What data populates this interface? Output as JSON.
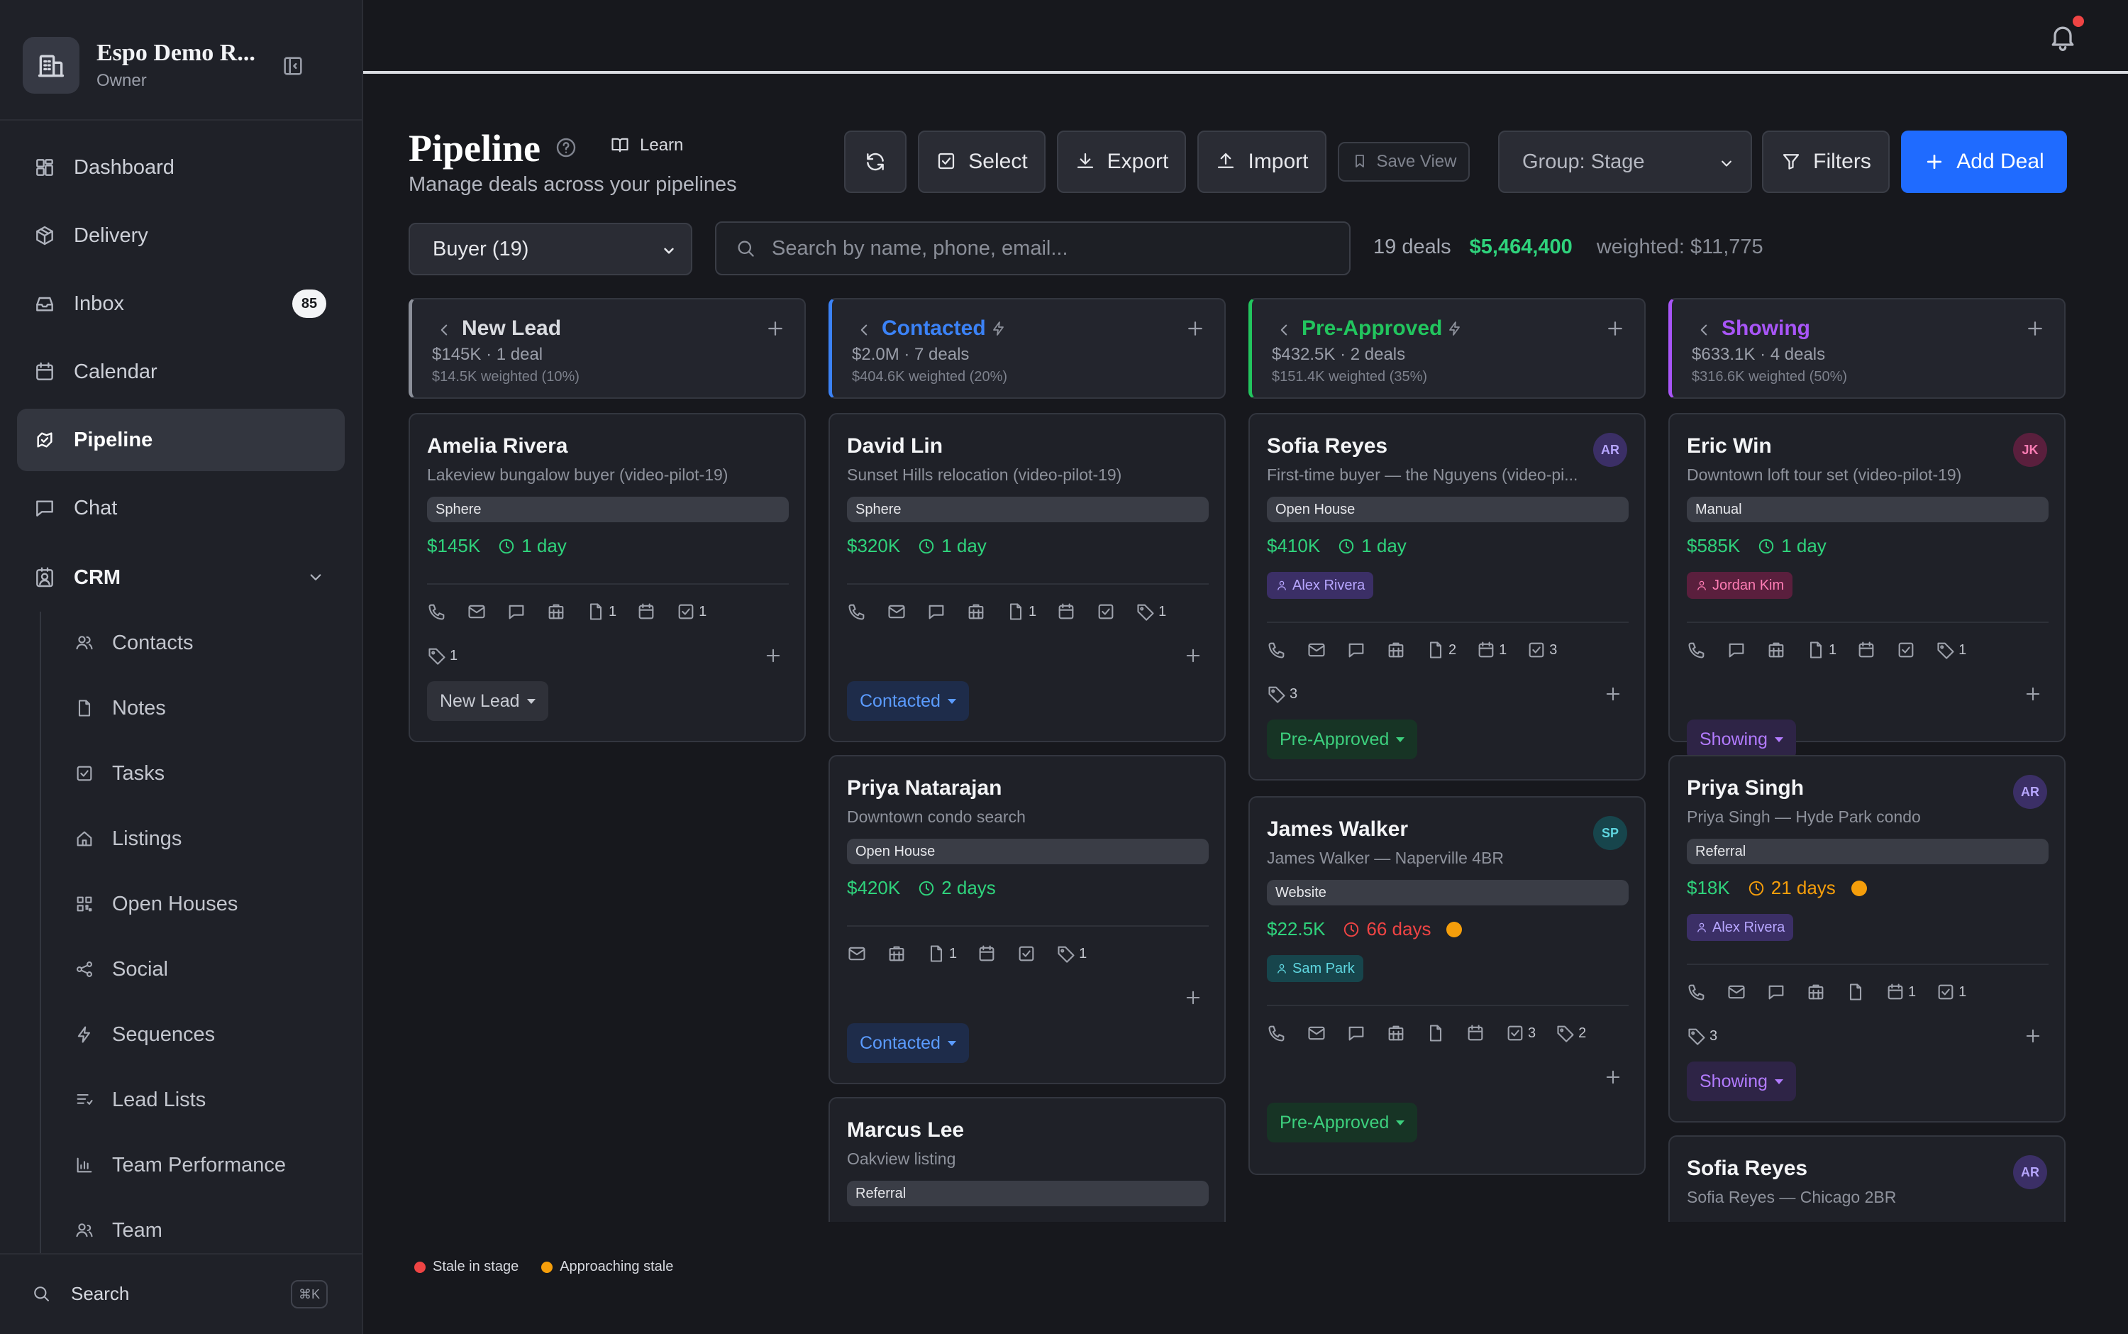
{
  "workspace": {
    "name": "Espo Demo R...",
    "role": "Owner"
  },
  "nav": {
    "items": [
      {
        "label": "Dashboard",
        "icon": "dashboard-icon"
      },
      {
        "label": "Delivery",
        "icon": "package-icon"
      },
      {
        "label": "Inbox",
        "icon": "inbox-icon",
        "badge": "85"
      },
      {
        "label": "Calendar",
        "icon": "calendar-icon"
      },
      {
        "label": "Pipeline",
        "icon": "pipeline-icon",
        "active": true
      },
      {
        "label": "Chat",
        "icon": "chat-icon"
      },
      {
        "label": "CRM",
        "icon": "crm-icon",
        "expanded": true
      }
    ],
    "crm_items": [
      {
        "label": "Contacts",
        "icon": "contacts-icon"
      },
      {
        "label": "Notes",
        "icon": "notes-icon"
      },
      {
        "label": "Tasks",
        "icon": "tasks-icon"
      },
      {
        "label": "Listings",
        "icon": "home-icon"
      },
      {
        "label": "Open Houses",
        "icon": "qr-icon"
      },
      {
        "label": "Social",
        "icon": "share-icon"
      },
      {
        "label": "Sequences",
        "icon": "bolt-icon"
      },
      {
        "label": "Lead Lists",
        "icon": "list-icon"
      },
      {
        "label": "Team Performance",
        "icon": "bar-chart-icon"
      },
      {
        "label": "Team",
        "icon": "team-icon"
      }
    ],
    "search_label": "Search",
    "search_shortcut": "⌘K"
  },
  "header": {
    "title": "Pipeline",
    "subtitle": "Manage deals across your pipelines",
    "learn_label": "Learn",
    "toolbar": {
      "select_label": "Select",
      "export_label": "Export",
      "import_label": "Import",
      "save_view_label": "Save View",
      "group_value": "Group: Stage",
      "filters_label": "Filters",
      "add_deal_label": "Add Deal"
    }
  },
  "filters": {
    "pipeline_value": "Buyer (19)",
    "search_placeholder": "Search by name, phone, email..."
  },
  "stats": {
    "count": "19 deals",
    "total": "$5,464,400",
    "weighted": "weighted: $11,775"
  },
  "colors": {
    "new_lead": "#8b8f99",
    "contacted": "#3b82f6",
    "pre_approved": "#22c55e",
    "showing": "#a855f7",
    "value": "#2fd37c",
    "stale": "#ef4444",
    "approaching_stale": "#f59e0b",
    "accent": "#1f6bff"
  },
  "columns": [
    {
      "title": "New Lead",
      "summary": "$145K · 1 deal",
      "weighted": "$14.5K weighted (10%)",
      "cards": [
        {
          "name": "Amelia Rivera",
          "desc": "Lakeview bungalow buyer (video-pilot-19)",
          "source": "Sphere",
          "value": "$145K",
          "age": "1 day",
          "actions": [
            [
              "phone-icon",
              ""
            ],
            [
              "mail-icon",
              ""
            ],
            [
              "message-icon",
              ""
            ],
            [
              "building-icon",
              ""
            ],
            [
              "file-icon",
              "1"
            ],
            [
              "calendar-icon",
              ""
            ],
            [
              "checkbox-icon",
              "1"
            ]
          ],
          "actions2": [
            [
              "tag-icon",
              "1"
            ]
          ],
          "stage": "New Lead"
        }
      ]
    },
    {
      "title": "Contacted",
      "summary": "$2.0M · 7 deals",
      "weighted": "$404.6K weighted (20%)",
      "cards": [
        {
          "name": "David Lin",
          "desc": "Sunset Hills relocation (video-pilot-19)",
          "source": "Sphere",
          "value": "$320K",
          "age": "1 day",
          "actions": [
            [
              "phone-icon",
              ""
            ],
            [
              "mail-icon",
              ""
            ],
            [
              "message-icon",
              ""
            ],
            [
              "building-icon",
              ""
            ],
            [
              "file-icon",
              "1"
            ],
            [
              "calendar-icon",
              ""
            ],
            [
              "checkbox-icon",
              ""
            ],
            [
              "tag-icon",
              "1"
            ]
          ],
          "stage": "Contacted"
        },
        {
          "name": "Priya Natarajan",
          "desc": "Downtown condo search",
          "source": "Open House",
          "value": "$420K",
          "age": "2 days",
          "actions": [
            [
              "mail-icon",
              ""
            ],
            [
              "building-icon",
              ""
            ],
            [
              "file-icon",
              "1"
            ],
            [
              "calendar-icon",
              ""
            ],
            [
              "checkbox-icon",
              ""
            ],
            [
              "tag-icon",
              "1"
            ]
          ],
          "stage": "Contacted"
        },
        {
          "name": "Marcus Lee",
          "desc": "Oakview listing",
          "source": "Referral"
        }
      ]
    },
    {
      "title": "Pre-Approved",
      "summary": "$432.5K · 2 deals",
      "weighted": "$151.4K weighted (35%)",
      "cards": [
        {
          "name": "Sofia Reyes",
          "desc": "First-time buyer — the Nguyens (video-pi...",
          "avatar": "AR",
          "source": "Open House",
          "value": "$410K",
          "age": "1 day",
          "agent": "Alex Rivera",
          "actions": [
            [
              "phone-icon",
              ""
            ],
            [
              "mail-icon",
              ""
            ],
            [
              "message-icon",
              ""
            ],
            [
              "building-icon",
              ""
            ],
            [
              "file-icon",
              "2"
            ],
            [
              "calendar-icon",
              "1"
            ],
            [
              "checkbox-icon",
              "3"
            ]
          ],
          "actions2": [
            [
              "tag-icon",
              "3"
            ]
          ],
          "stage": "Pre-Approved"
        },
        {
          "name": "James Walker",
          "desc": "James Walker — Naperville 4BR",
          "avatar": "SP",
          "source": "Website",
          "value": "$22.5K",
          "age": "66 days",
          "agent": "Sam Park",
          "actions": [
            [
              "phone-icon",
              ""
            ],
            [
              "mail-icon",
              ""
            ],
            [
              "message-icon",
              ""
            ],
            [
              "building-icon",
              ""
            ],
            [
              "file-icon",
              ""
            ],
            [
              "calendar-icon",
              ""
            ],
            [
              "checkbox-icon",
              "3"
            ],
            [
              "tag-icon",
              "2"
            ]
          ],
          "stage": "Pre-Approved"
        }
      ]
    },
    {
      "title": "Showing",
      "summary": "$633.1K · 4 deals",
      "weighted": "$316.6K weighted (50%)",
      "cards": [
        {
          "name": "Eric Win",
          "desc": "Downtown loft tour set (video-pilot-19)",
          "avatar": "JK",
          "source": "Manual",
          "value": "$585K",
          "age": "1 day",
          "agent": "Jordan Kim",
          "actions": [
            [
              "phone-icon",
              ""
            ],
            [
              "message-icon",
              ""
            ],
            [
              "building-icon",
              ""
            ],
            [
              "file-icon",
              "1"
            ],
            [
              "calendar-icon",
              ""
            ],
            [
              "checkbox-icon",
              ""
            ],
            [
              "tag-icon",
              "1"
            ]
          ],
          "stage": "Showing"
        },
        {
          "name": "Priya Singh",
          "desc": "Priya Singh — Hyde Park condo",
          "avatar": "AR",
          "source": "Referral",
          "value": "$18K",
          "age": "21 days",
          "agent": "Alex Rivera",
          "actions": [
            [
              "phone-icon",
              ""
            ],
            [
              "mail-icon",
              ""
            ],
            [
              "message-icon",
              ""
            ],
            [
              "building-icon",
              ""
            ],
            [
              "file-icon",
              ""
            ],
            [
              "calendar-icon",
              "1"
            ],
            [
              "checkbox-icon",
              "1"
            ]
          ],
          "actions2": [
            [
              "tag-icon",
              "3"
            ]
          ],
          "stage": "Showing"
        },
        {
          "name": "Sofia Reyes",
          "desc": "Sofia Reyes — Chicago 2BR",
          "avatar": "AR"
        }
      ]
    }
  ],
  "legend": {
    "stale": "Stale in stage",
    "approaching": "Approaching stale"
  }
}
